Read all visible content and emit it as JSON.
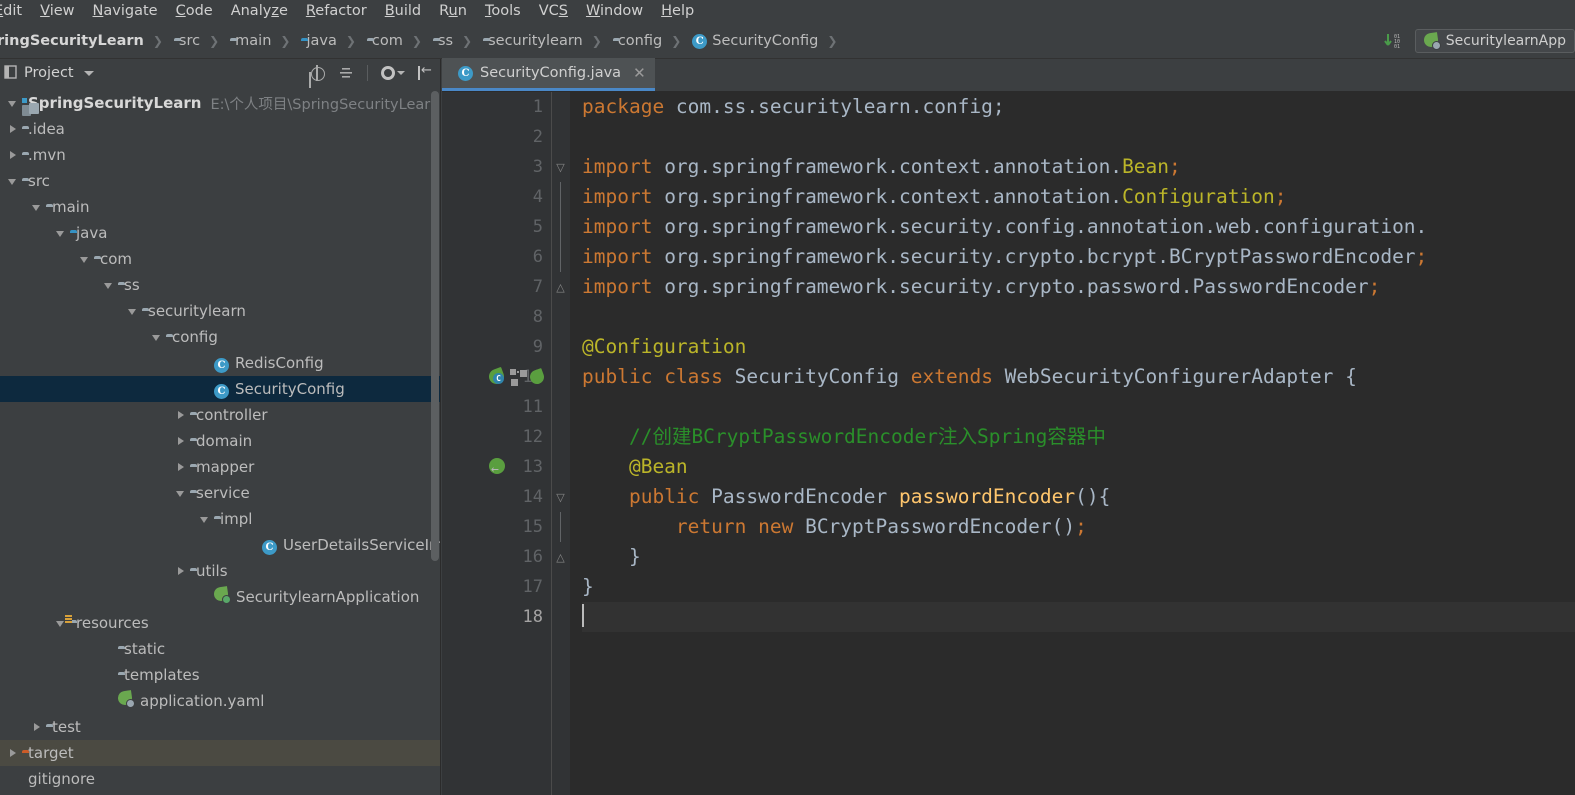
{
  "menubar": {
    "items": [
      {
        "label": "Edit",
        "mnemonic": "E"
      },
      {
        "label": "View",
        "mnemonic": "V"
      },
      {
        "label": "Navigate",
        "mnemonic": "N"
      },
      {
        "label": "Code",
        "mnemonic": "C"
      },
      {
        "label": "Analyze",
        "mnemonic": "z"
      },
      {
        "label": "Refactor",
        "mnemonic": "R"
      },
      {
        "label": "Build",
        "mnemonic": "B"
      },
      {
        "label": "Run",
        "mnemonic": "u"
      },
      {
        "label": "Tools",
        "mnemonic": "T"
      },
      {
        "label": "VCS",
        "mnemonic": "S"
      },
      {
        "label": "Window",
        "mnemonic": "W"
      },
      {
        "label": "Help",
        "mnemonic": "H"
      }
    ]
  },
  "breadcrumb": {
    "items": [
      {
        "label": "ringSecurityLearn",
        "icon": "project-icon",
        "bold": true
      },
      {
        "label": "src",
        "icon": "folder-icon"
      },
      {
        "label": "main",
        "icon": "folder-icon"
      },
      {
        "label": "java",
        "icon": "source-folder-icon"
      },
      {
        "label": "com",
        "icon": "package-icon"
      },
      {
        "label": "ss",
        "icon": "package-icon"
      },
      {
        "label": "securitylearn",
        "icon": "package-icon"
      },
      {
        "label": "config",
        "icon": "package-icon"
      },
      {
        "label": "SecurityConfig",
        "icon": "class-icon"
      }
    ]
  },
  "toolbar_right": {
    "download_icon": "download-binary-icon",
    "run_config_label": "SecuritylearnApp",
    "run_config_icon": "spring-boot-icon"
  },
  "project_panel": {
    "title": "Project",
    "dropdown_icon": "chevron-down-icon",
    "tools": [
      {
        "name": "locate-icon"
      },
      {
        "name": "collapse-all-icon"
      },
      {
        "name": "settings-gear-icon"
      },
      {
        "name": "hide-panel-icon"
      }
    ],
    "tree": [
      {
        "indent": 0,
        "arrow": "down",
        "icon": "project-icon",
        "label": "SpringSecurityLearn",
        "bold": true,
        "sublabel": "E:\\个人项目\\SpringSecurityLearn",
        "state": "normal"
      },
      {
        "indent": 0,
        "arrow": "right",
        "icon": "folder-icon",
        "label": ".idea",
        "state": "normal"
      },
      {
        "indent": 0,
        "arrow": "right",
        "icon": "folder-icon",
        "label": ".mvn",
        "state": "normal"
      },
      {
        "indent": 0,
        "arrow": "down",
        "icon": "folder-icon",
        "label": "src",
        "state": "normal"
      },
      {
        "indent": 1,
        "arrow": "down",
        "icon": "folder-icon",
        "label": "main",
        "state": "normal"
      },
      {
        "indent": 2,
        "arrow": "down",
        "icon": "source-folder-icon",
        "label": "java",
        "state": "normal"
      },
      {
        "indent": 3,
        "arrow": "down",
        "icon": "package-icon",
        "label": "com",
        "state": "normal"
      },
      {
        "indent": 4,
        "arrow": "down",
        "icon": "package-icon",
        "label": "ss",
        "state": "normal"
      },
      {
        "indent": 5,
        "arrow": "down",
        "icon": "package-icon",
        "label": "securitylearn",
        "state": "normal"
      },
      {
        "indent": 6,
        "arrow": "down",
        "icon": "package-icon",
        "label": "config",
        "state": "normal"
      },
      {
        "indent": 8,
        "arrow": "none",
        "icon": "class-icon",
        "label": "RedisConfig",
        "state": "normal"
      },
      {
        "indent": 8,
        "arrow": "none",
        "icon": "class-icon",
        "label": "SecurityConfig",
        "state": "selected"
      },
      {
        "indent": 7,
        "arrow": "right",
        "icon": "package-icon",
        "label": "controller",
        "state": "normal"
      },
      {
        "indent": 7,
        "arrow": "right",
        "icon": "package-icon",
        "label": "domain",
        "state": "normal"
      },
      {
        "indent": 7,
        "arrow": "right",
        "icon": "package-icon",
        "label": "mapper",
        "state": "normal"
      },
      {
        "indent": 7,
        "arrow": "down",
        "icon": "package-icon",
        "label": "service",
        "state": "normal"
      },
      {
        "indent": 8,
        "arrow": "down",
        "icon": "package-icon",
        "label": "impl",
        "state": "normal"
      },
      {
        "indent": 10,
        "arrow": "none",
        "icon": "class-icon",
        "label": "UserDetailsServiceImpl",
        "state": "normal"
      },
      {
        "indent": 7,
        "arrow": "right",
        "icon": "package-icon",
        "label": "utils",
        "state": "normal"
      },
      {
        "indent": 8,
        "arrow": "none",
        "icon": "spring-run-icon",
        "label": "SecuritylearnApplication",
        "state": "normal"
      },
      {
        "indent": 2,
        "arrow": "down",
        "icon": "resources-folder-icon",
        "label": "resources",
        "state": "normal"
      },
      {
        "indent": 4,
        "arrow": "none",
        "icon": "package-icon",
        "label": "static",
        "state": "normal"
      },
      {
        "indent": 4,
        "arrow": "none",
        "icon": "package-icon",
        "label": "templates",
        "state": "normal"
      },
      {
        "indent": 4,
        "arrow": "none",
        "icon": "spring-yaml-icon",
        "label": "application.yaml",
        "state": "normal"
      },
      {
        "indent": 1,
        "arrow": "right",
        "icon": "folder-icon",
        "label": "test",
        "state": "normal"
      },
      {
        "indent": 0,
        "arrow": "right",
        "icon": "target-folder-icon",
        "label": "target",
        "state": "hovered"
      },
      {
        "indent": 0,
        "arrow": "none",
        "icon": "file-icon",
        "label": "gitignore",
        "state": "normal"
      }
    ]
  },
  "editor": {
    "tab": {
      "label": "SecurityConfig.java",
      "icon": "class-icon",
      "close_icon": "close-icon",
      "active": true
    },
    "lines": [
      {
        "num": "1",
        "gutter_icons": [],
        "fold": "none",
        "current": false,
        "tokens": [
          {
            "t": "package ",
            "c": "kw"
          },
          {
            "t": "com.ss.securitylearn.config;",
            "c": "pun"
          }
        ]
      },
      {
        "num": "2",
        "gutter_icons": [],
        "fold": "none",
        "current": false,
        "tokens": []
      },
      {
        "num": "3",
        "gutter_icons": [],
        "fold": "start",
        "current": false,
        "tokens": [
          {
            "t": "import ",
            "c": "kw"
          },
          {
            "t": "org.springframework.context.annotation.",
            "c": "cls"
          },
          {
            "t": "Bean",
            "c": "ann"
          },
          {
            "t": ";",
            "c": "kw"
          }
        ]
      },
      {
        "num": "4",
        "gutter_icons": [],
        "fold": "mid",
        "current": false,
        "tokens": [
          {
            "t": "import ",
            "c": "kw"
          },
          {
            "t": "org.springframework.context.annotation.",
            "c": "cls"
          },
          {
            "t": "Configuration",
            "c": "ann"
          },
          {
            "t": ";",
            "c": "kw"
          }
        ]
      },
      {
        "num": "5",
        "gutter_icons": [],
        "fold": "mid",
        "current": false,
        "tokens": [
          {
            "t": "import ",
            "c": "kw"
          },
          {
            "t": "org.springframework.security.config.annotation.web.configuration.",
            "c": "cls"
          }
        ]
      },
      {
        "num": "6",
        "gutter_icons": [],
        "fold": "mid",
        "current": false,
        "tokens": [
          {
            "t": "import ",
            "c": "kw"
          },
          {
            "t": "org.springframework.security.crypto.bcrypt.BCryptPasswordEncoder",
            "c": "cls"
          },
          {
            "t": ";",
            "c": "kw"
          }
        ]
      },
      {
        "num": "7",
        "gutter_icons": [],
        "fold": "end",
        "current": false,
        "tokens": [
          {
            "t": "import ",
            "c": "kw"
          },
          {
            "t": "org.springframework.security.crypto.password.PasswordEncoder",
            "c": "cls"
          },
          {
            "t": ";",
            "c": "kw"
          }
        ]
      },
      {
        "num": "8",
        "gutter_icons": [],
        "fold": "none",
        "current": false,
        "tokens": []
      },
      {
        "num": "9",
        "gutter_icons": [],
        "fold": "none",
        "current": false,
        "tokens": [
          {
            "t": "@Configuration",
            "c": "ann"
          }
        ]
      },
      {
        "num": "10",
        "gutter_icons": [
          "spring-bean-icon",
          "class-structure-icon",
          "spring-leaf-icon"
        ],
        "fold": "none",
        "current": false,
        "tokens": [
          {
            "t": "public ",
            "c": "kw"
          },
          {
            "t": "class ",
            "c": "kw"
          },
          {
            "t": "SecurityConfig ",
            "c": "cls"
          },
          {
            "t": "extends ",
            "c": "kw"
          },
          {
            "t": "WebSecurityConfigurerAdapter {",
            "c": "cls"
          }
        ]
      },
      {
        "num": "11",
        "gutter_icons": [],
        "fold": "none",
        "current": false,
        "tokens": []
      },
      {
        "num": "12",
        "gutter_icons": [],
        "fold": "none",
        "current": false,
        "tokens": [
          {
            "t": "    //创建BCryptPasswordEncoder注入Spring容器中",
            "c": "cmt"
          }
        ]
      },
      {
        "num": "13",
        "gutter_icons": [
          "spring-bean-arrow-icon"
        ],
        "fold": "none",
        "current": false,
        "tokens": [
          {
            "t": "    @Bean",
            "c": "ann"
          }
        ]
      },
      {
        "num": "14",
        "gutter_icons": [],
        "fold": "start",
        "current": false,
        "tokens": [
          {
            "t": "    ",
            "c": "pun"
          },
          {
            "t": "public ",
            "c": "kw"
          },
          {
            "t": "PasswordEncoder ",
            "c": "cls"
          },
          {
            "t": "passwordEncoder",
            "c": "mth"
          },
          {
            "t": "(){",
            "c": "pun"
          }
        ]
      },
      {
        "num": "15",
        "gutter_icons": [],
        "fold": "mid",
        "current": false,
        "tokens": [
          {
            "t": "        ",
            "c": "pun"
          },
          {
            "t": "return ",
            "c": "kw"
          },
          {
            "t": "new ",
            "c": "kw"
          },
          {
            "t": "BCryptPasswordEncoder",
            "c": "cls"
          },
          {
            "t": "()",
            "c": "pun"
          },
          {
            "t": ";",
            "c": "kw"
          }
        ]
      },
      {
        "num": "16",
        "gutter_icons": [],
        "fold": "end",
        "current": false,
        "tokens": [
          {
            "t": "    }",
            "c": "pun"
          }
        ]
      },
      {
        "num": "17",
        "gutter_icons": [],
        "fold": "none",
        "current": false,
        "tokens": [
          {
            "t": "}",
            "c": "pun"
          }
        ]
      },
      {
        "num": "18",
        "gutter_icons": [],
        "fold": "none",
        "current": true,
        "tokens": [],
        "caret": true
      }
    ]
  },
  "colors": {
    "editor_bg": "#2b2b2b",
    "panel_bg": "#3c3f41",
    "gutter_bg": "#313335",
    "selection": "#0d293e",
    "hover": "#4b4a42",
    "tab_active_underline": "#4a88c7",
    "keyword": "#cc7832",
    "annotation": "#bbb529",
    "comment": "#2a8f2a",
    "method": "#ffc66d",
    "text": "#a9b7c6"
  }
}
